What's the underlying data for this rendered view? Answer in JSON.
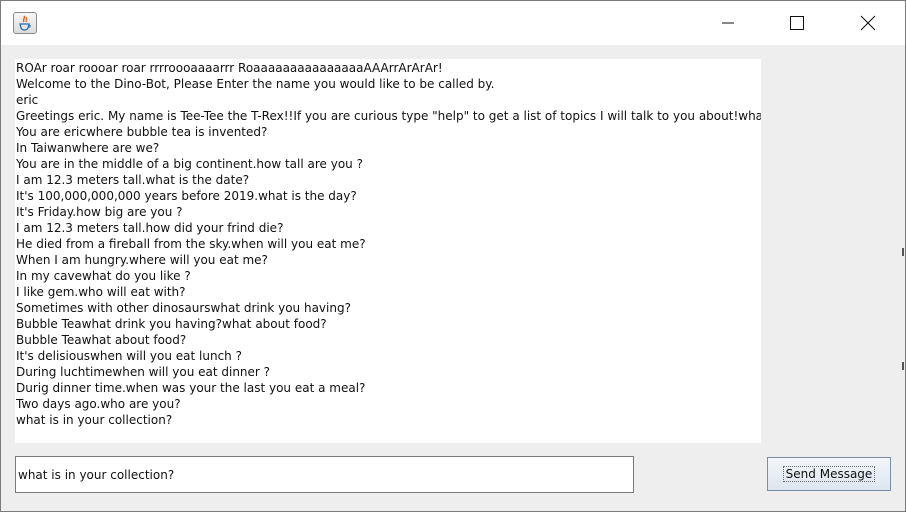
{
  "window": {
    "title": "",
    "controls": {
      "minimize": "minimize",
      "maximize": "maximize",
      "close": "close"
    }
  },
  "chat": {
    "lines": [
      "ROAr roar roooar roar rrrroooaaaarrr RoaaaaaaaaaaaaaaaAAArrArArAr!",
      "Welcome to the Dino-Bot, Please Enter the name you would like to be called by.",
      "eric",
      "Greetings eric. My name is Tee-Tee the T-Rex!!If you are curious type \"help\" to get a list of topics I will talk to you about!what is my name ?",
      "You are ericwhere bubble tea is invented?",
      "In Taiwanwhere are we?",
      "You are in the middle of a big continent.how tall are you ?",
      "I am 12.3 meters tall.what is the date?",
      "It's 100,000,000,000 years before 2019.what is the day?",
      "It's Friday.how big are you ?",
      "I am 12.3 meters tall.how did your frind die?",
      "He died from a fireball from the sky.when will you eat me?",
      "When I am hungry.where will you eat me?",
      "In my cavewhat do you like ?",
      "I like gem.who will eat with?",
      "Sometimes with other dinosaurswhat drink you having?",
      "Bubble Teawhat drink you having?what about food?",
      "Bubble Teawhat about food?",
      "It's delisiouswhen will you eat lunch ?",
      "During luchtimewhen will you eat dinner ?",
      "Durig dinner time.when was your the last you eat a meal?",
      "Two days ago.who are you?",
      "what is in your collection?"
    ]
  },
  "input": {
    "value": "what is in your collection?"
  },
  "send_button": {
    "label": "Send Message"
  }
}
